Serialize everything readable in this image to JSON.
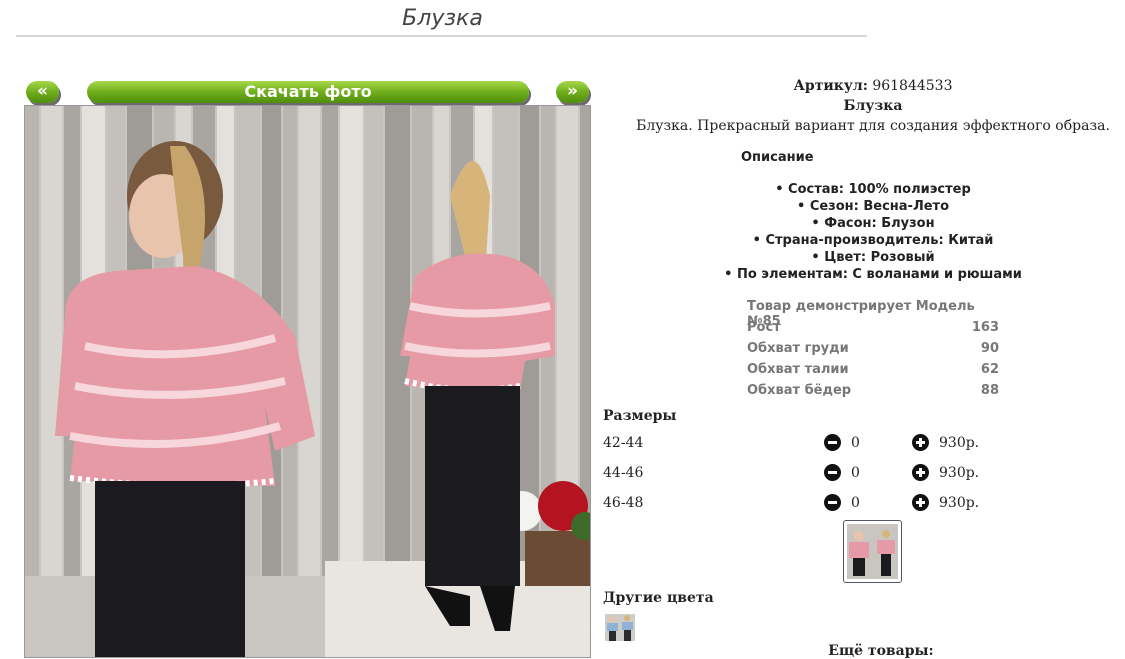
{
  "page": {
    "title": "Блузка"
  },
  "gallery": {
    "prev_label": "«",
    "download_label": "Скачать фото",
    "next_label": "»"
  },
  "product": {
    "sku_label": "Артикул:",
    "sku_value": "961844533",
    "name": "Блузка",
    "description": "Блузка. Прекрасный вариант для создания эффектного образа.",
    "description_heading": "Описание",
    "attributes": [
      "Состав: 100% полиэстер",
      "Сезон: Весна-Лето",
      "Фасон: Блузон",
      "Страна-производитель: Китай",
      "Цвет: Розовый",
      "По элементам: С воланами и рюшами"
    ]
  },
  "model": {
    "heading": "Товар демонстрирует Модель №85",
    "rows": [
      {
        "label": "Рост",
        "value": "163"
      },
      {
        "label": "Обхват груди",
        "value": "90"
      },
      {
        "label": "Обхват талии",
        "value": "62"
      },
      {
        "label": "Обхват бёдер",
        "value": "88"
      }
    ]
  },
  "sizes": {
    "heading": "Размеры",
    "rows": [
      {
        "size": "42-44",
        "qty": "0",
        "price": "930р."
      },
      {
        "size": "44-46",
        "qty": "0",
        "price": "930р."
      },
      {
        "size": "46-48",
        "qty": "0",
        "price": "930р."
      }
    ]
  },
  "other_colors": {
    "heading": "Другие цвета"
  },
  "more": {
    "heading": "Ещё товары:"
  },
  "colors": {
    "button_green": "#6fae1c",
    "blouse_pink": "#e59aa6",
    "pants": "#1b1b1f"
  },
  "icons": [
    "minus-circle-icon",
    "plus-circle-icon"
  ]
}
